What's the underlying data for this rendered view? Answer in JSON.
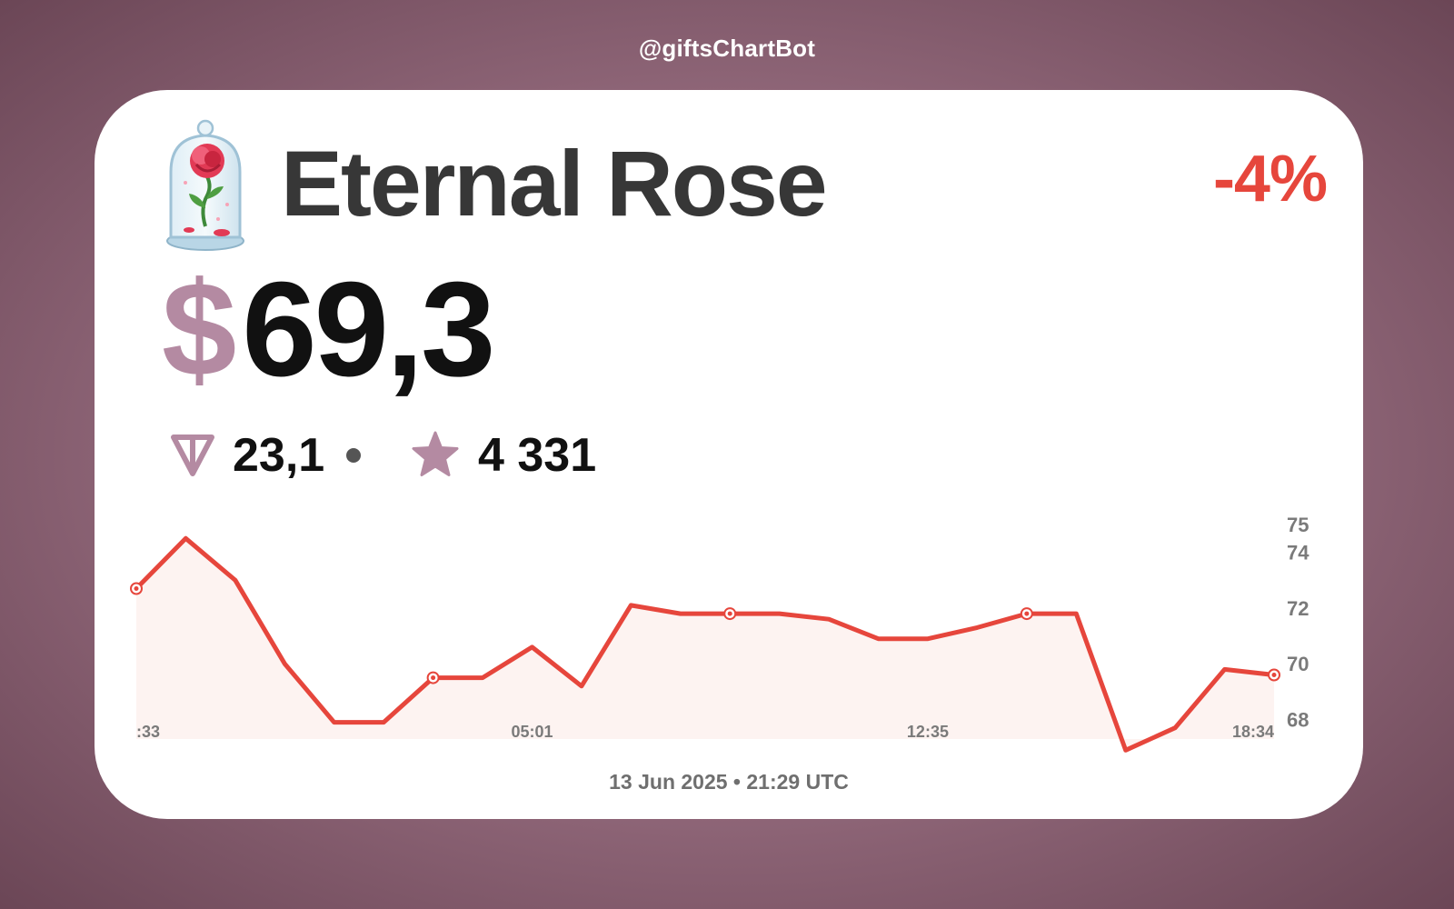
{
  "brand": "@giftsChartBot",
  "gift": {
    "name": "Eternal Rose",
    "change": "-4%",
    "price_currency": "$",
    "price_value": "69,3",
    "ton_value": "23,1",
    "stars_value": "4 331",
    "icon": "eternal-rose-icon"
  },
  "footer": "13 Jun 2025 • 21:29 UTC",
  "colors": {
    "line": "#e6463c",
    "fill": "#fdf3f1",
    "accent": "#b48aa2",
    "title": "#373737"
  },
  "chart_data": {
    "type": "area",
    "ylim": [
      67.3,
      75
    ],
    "yticks": [
      "75",
      "74",
      "72",
      "70",
      "68"
    ],
    "xtick_labels": [
      ":33",
      "05:01",
      "12:35",
      "18:34"
    ],
    "xtick_index": [
      0,
      8,
      16,
      23
    ],
    "grid": false,
    "legend": "none",
    "values": [
      72.7,
      74.5,
      73.0,
      70.0,
      67.9,
      67.9,
      69.5,
      69.5,
      70.6,
      69.2,
      72.1,
      71.8,
      71.8,
      71.8,
      71.6,
      70.9,
      70.9,
      71.3,
      71.8,
      71.8,
      66.9,
      67.7,
      69.8,
      69.6
    ],
    "markers": [
      0,
      6,
      12,
      18,
      23
    ]
  }
}
